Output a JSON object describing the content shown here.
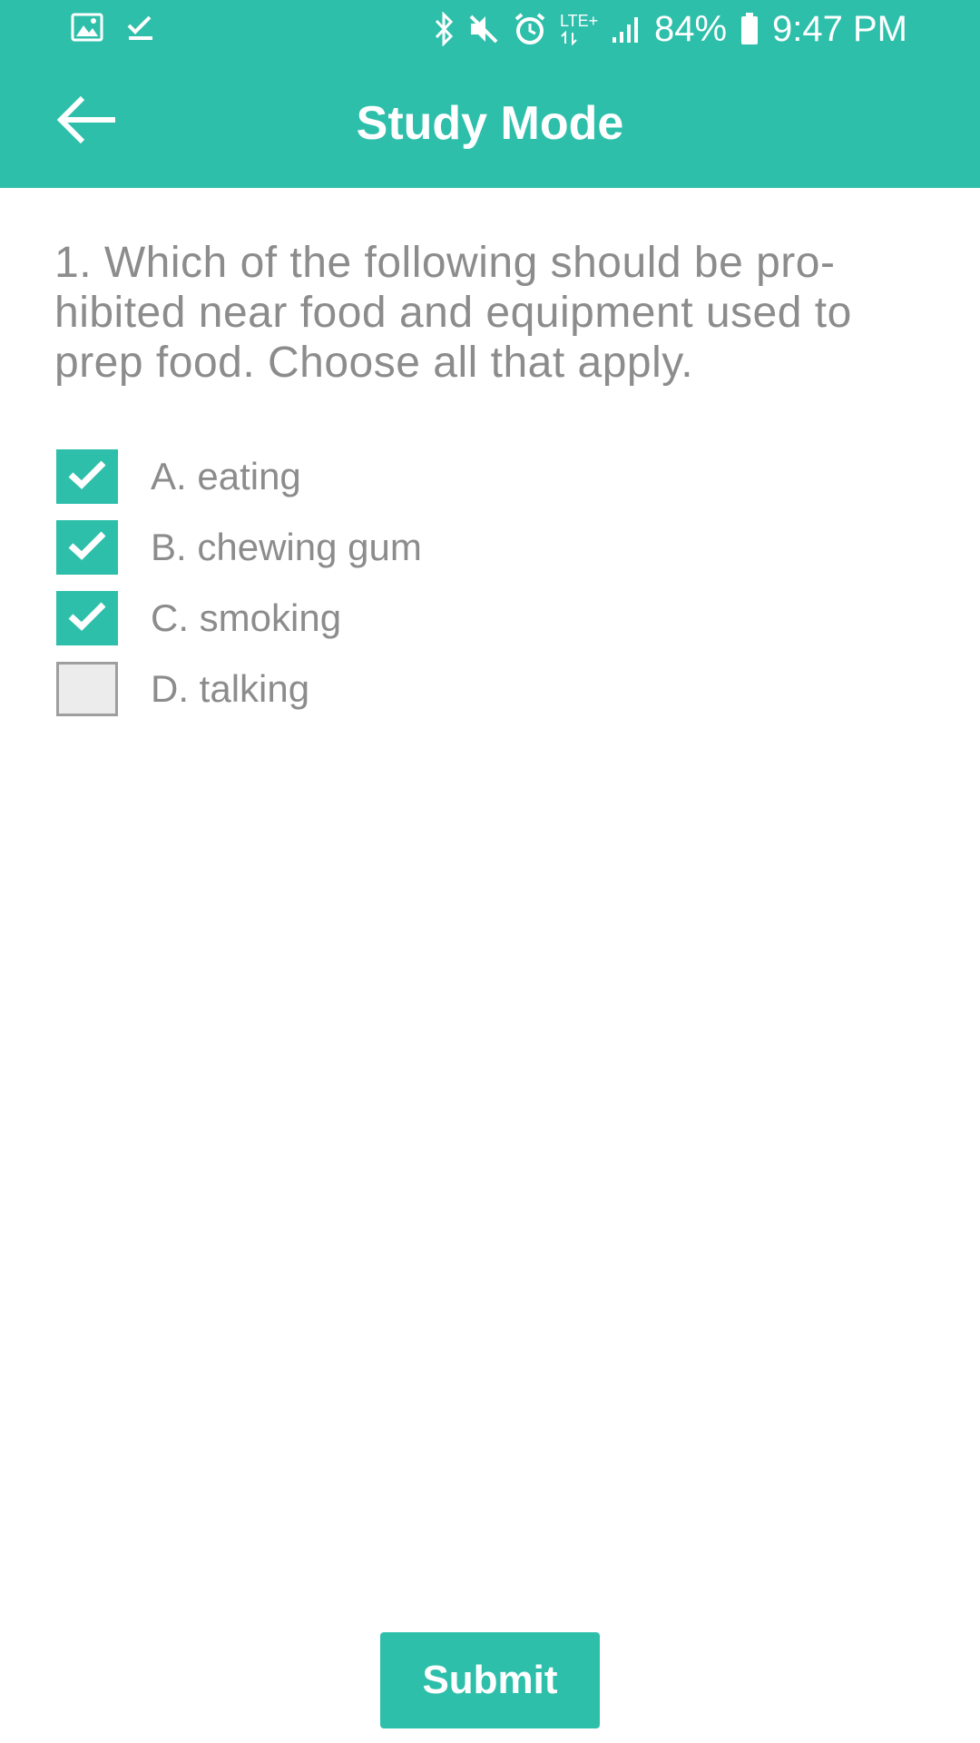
{
  "status_bar": {
    "battery": "84%",
    "time": "9:47 PM",
    "network": "LTE+",
    "icons_left": [
      "image-icon",
      "download-done-icon"
    ],
    "icons_right": [
      "bluetooth-icon",
      "mute-icon",
      "alarm-icon",
      "lte-icon",
      "signal-icon",
      "battery-icon"
    ]
  },
  "app_bar": {
    "title": "Study Mode",
    "back_icon": "arrow-back-icon"
  },
  "question": {
    "text": "1. Which of the following should be pro-hibited near food and equipment used to prep food.  Choose all that apply."
  },
  "options": [
    {
      "label": "A. eating",
      "checked": true
    },
    {
      "label": "B. chewing gum",
      "checked": true
    },
    {
      "label": "C. smoking",
      "checked": true
    },
    {
      "label": "D. talking",
      "checked": false
    }
  ],
  "submit": {
    "label": "Submit"
  },
  "colors": {
    "accent": "#2ebfab",
    "text": "#8c8c8c",
    "unchecked_fill": "#ececec"
  }
}
